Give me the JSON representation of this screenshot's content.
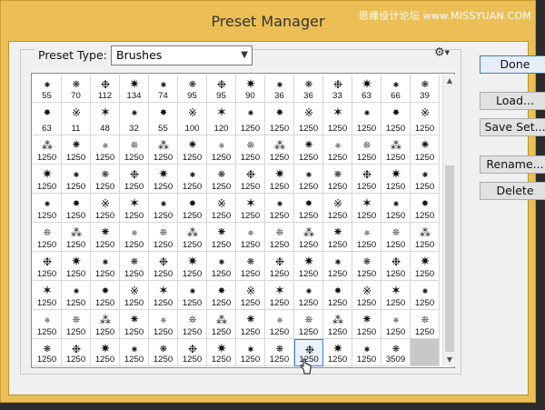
{
  "window": {
    "title": "Preset Manager",
    "watermark": "思缘设计论坛 www.MISSYUAN.COM"
  },
  "preset_type": {
    "label": "Preset Type:",
    "value": "Brushes"
  },
  "buttons": {
    "done": "Done",
    "load": "Load...",
    "save_set": "Save Set...",
    "rename": "Rename...",
    "delete": "Delete"
  },
  "brush_rows": [
    [
      "55",
      "70",
      "112",
      "134",
      "74",
      "95",
      "95",
      "90",
      "36",
      "36",
      "33",
      "63",
      "66",
      "39"
    ],
    [
      "63",
      "11",
      "48",
      "32",
      "55",
      "100",
      "120",
      "1250",
      "1250",
      "1250",
      "1250",
      "1250",
      "1250",
      "1250"
    ],
    [
      "1250",
      "1250",
      "1250",
      "1250",
      "1250",
      "1250",
      "1250",
      "1250",
      "1250",
      "1250",
      "1250",
      "1250",
      "1250",
      "1250"
    ],
    [
      "1250",
      "1250",
      "1250",
      "1250",
      "1250",
      "1250",
      "1250",
      "1250",
      "1250",
      "1250",
      "1250",
      "1250",
      "1250",
      "1250"
    ],
    [
      "1250",
      "1250",
      "1250",
      "1250",
      "1250",
      "1250",
      "1250",
      "1250",
      "1250",
      "1250",
      "1250",
      "1250",
      "1250",
      "1250"
    ],
    [
      "1250",
      "1250",
      "1250",
      "1250",
      "1250",
      "1250",
      "1250",
      "1250",
      "1250",
      "1250",
      "1250",
      "1250",
      "1250",
      "1250"
    ],
    [
      "1250",
      "1250",
      "1250",
      "1250",
      "1250",
      "1250",
      "1250",
      "1250",
      "1250",
      "1250",
      "1250",
      "1250",
      "1250",
      "1250"
    ],
    [
      "1250",
      "1250",
      "1250",
      "1250",
      "1250",
      "1250",
      "1250",
      "1250",
      "1250",
      "1250",
      "1250",
      "1250",
      "1250",
      "1250"
    ],
    [
      "1250",
      "1250",
      "1250",
      "1250",
      "1250",
      "1250",
      "1250",
      "1250",
      "1250",
      "1250",
      "1250",
      "1250",
      "1250",
      "1250"
    ],
    [
      "1250",
      "1250",
      "1250",
      "1250",
      "1250",
      "1250",
      "1250",
      "1250",
      "1250",
      "1250",
      "1250",
      "1250",
      "3509",
      ""
    ]
  ],
  "icons": [
    "gear-icon",
    "chevron-down-icon",
    "scroll-up-icon",
    "scroll-down-icon",
    "hand-cursor-icon"
  ]
}
